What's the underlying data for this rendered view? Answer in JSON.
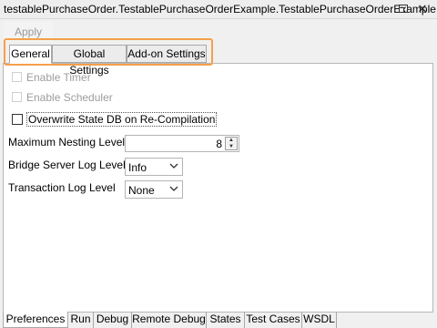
{
  "window": {
    "title": "testablePurchaseOrder.TestablePurchaseOrderExample.TestablePurchaseOrderExample",
    "close_glyph": "✕"
  },
  "toolbar": {
    "apply_label": "Apply"
  },
  "tabs": [
    {
      "label": "General",
      "selected": true
    },
    {
      "label": "Global Settings",
      "selected": false
    },
    {
      "label": "Add-on Settings",
      "selected": false
    }
  ],
  "general": {
    "enable_timer": {
      "label": "Enable Timer",
      "checked": false,
      "enabled": false
    },
    "enable_scheduler": {
      "label": "Enable Scheduler",
      "checked": false,
      "enabled": false
    },
    "overwrite_state_db": {
      "label": "Overwrite State DB on Re-Compilation",
      "checked": false,
      "enabled": true
    },
    "max_nesting": {
      "label": "Maximum Nesting Level",
      "value": "8"
    },
    "bridge_log": {
      "label": "Bridge Server Log Level",
      "value": "Info"
    },
    "transaction_log": {
      "label": "Transaction Log Level",
      "value": "None"
    }
  },
  "bottom_tabs": [
    {
      "label": "Preferences",
      "selected": true
    },
    {
      "label": "Run",
      "selected": false
    },
    {
      "label": "Debug",
      "selected": false
    },
    {
      "label": "Remote Debug",
      "selected": false
    },
    {
      "label": "States",
      "selected": false
    },
    {
      "label": "Test Cases",
      "selected": false
    },
    {
      "label": "WSDL",
      "selected": false
    }
  ],
  "icons": {
    "restore": "restore-window-icon",
    "close": "close-icon",
    "spin_up": "spin-up-arrow-icon",
    "spin_down": "spin-down-arrow-icon",
    "dropdown": "chevron-down-icon"
  },
  "colors": {
    "tab_highlight": "#f5a04a",
    "disabled_text": "#9d9d9d"
  }
}
